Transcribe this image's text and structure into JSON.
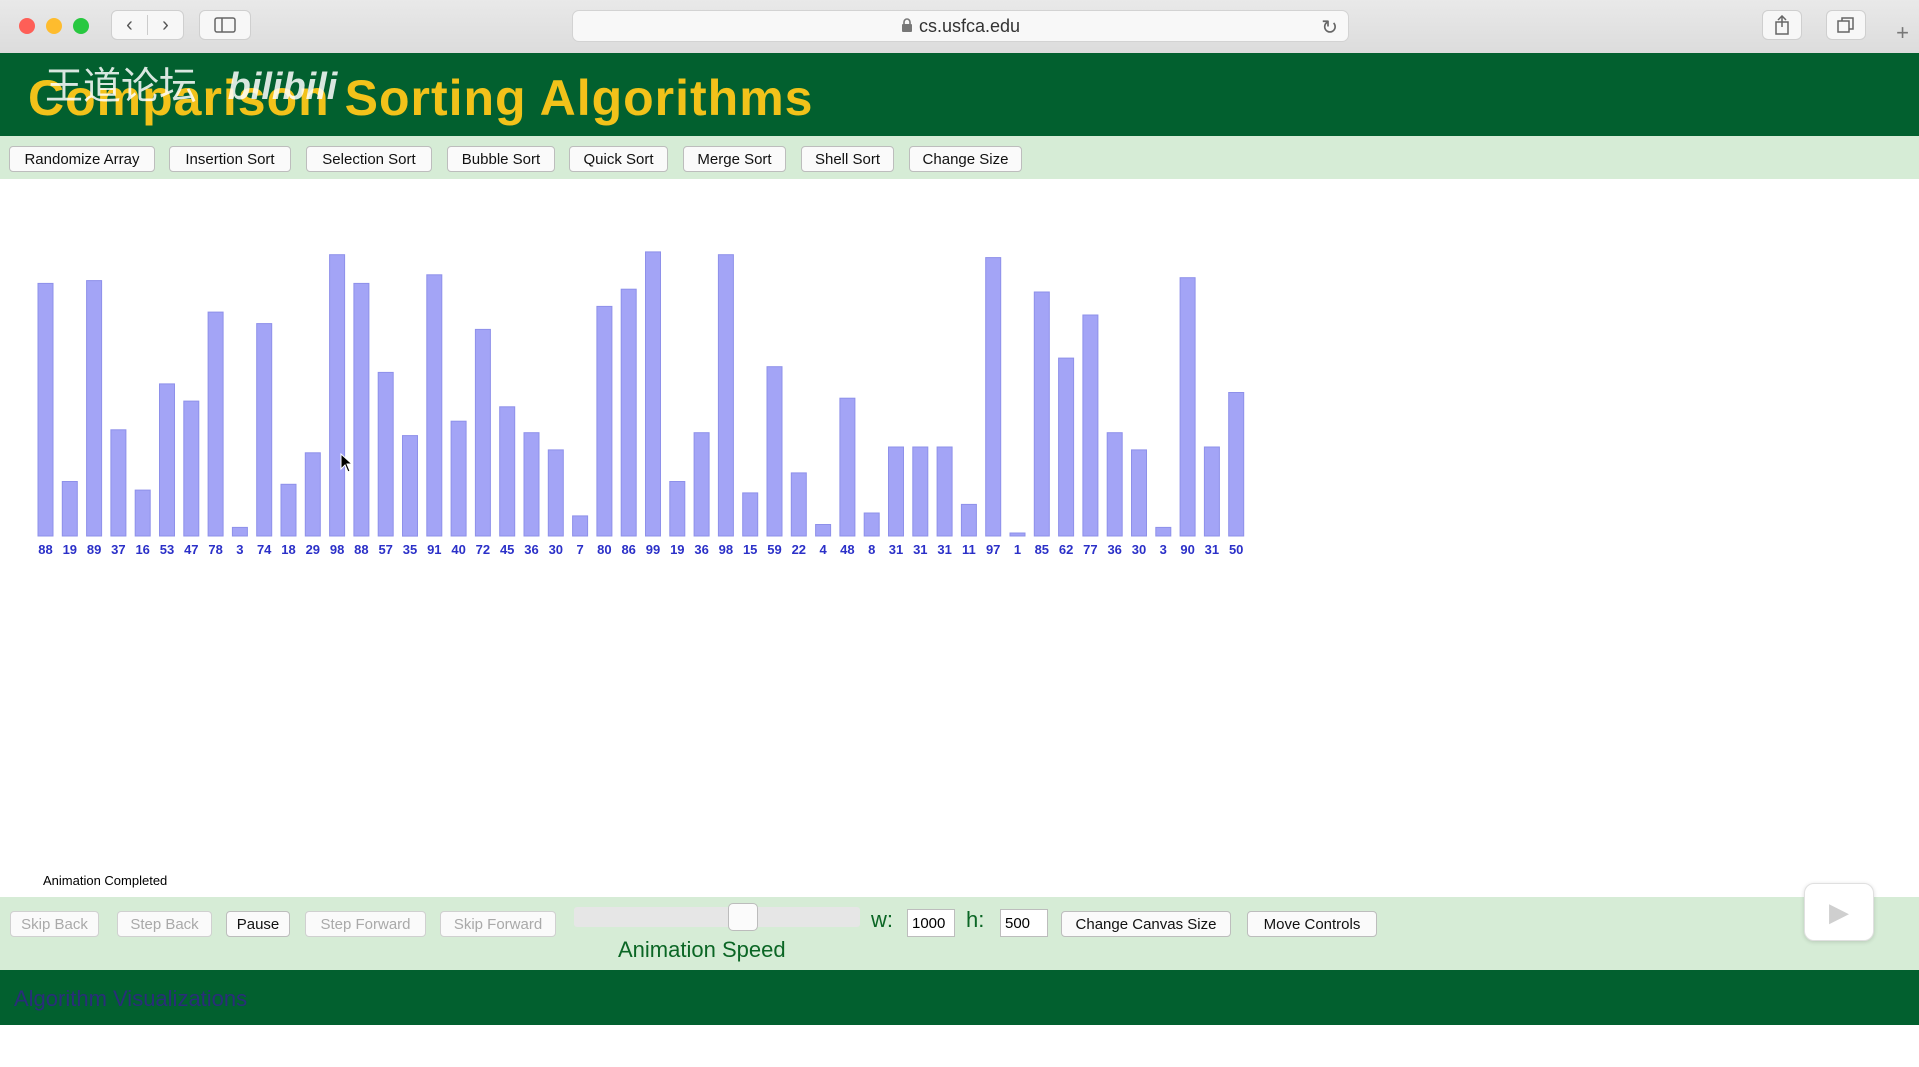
{
  "browser": {
    "url": "cs.usfca.edu",
    "icons": [
      "back-icon",
      "forward-icon",
      "sidebar-icon",
      "lock-icon",
      "reload-icon",
      "share-icon",
      "tabs-icon",
      "new-tab-icon"
    ]
  },
  "watermark": {
    "cn": "王道论坛",
    "bili": "bilibili"
  },
  "header": {
    "title": "Comparison Sorting Algorithms"
  },
  "toolbar": {
    "buttons": [
      "Randomize Array",
      "Insertion Sort",
      "Selection Sort",
      "Bubble Sort",
      "Quick Sort",
      "Merge Sort",
      "Shell Sort",
      "Change Size"
    ]
  },
  "chart_data": {
    "type": "bar",
    "categories": [
      "88",
      "19",
      "89",
      "37",
      "16",
      "53",
      "47",
      "78",
      "3",
      "74",
      "18",
      "29",
      "98",
      "88",
      "57",
      "35",
      "91",
      "40",
      "72",
      "45",
      "36",
      "30",
      "7",
      "80",
      "86",
      "99",
      "19",
      "36",
      "98",
      "15",
      "59",
      "22",
      "4",
      "48",
      "8",
      "31",
      "31",
      "31",
      "11",
      "97",
      "1",
      "85",
      "62",
      "77",
      "36",
      "30",
      "3",
      "90",
      "31",
      "50"
    ],
    "values": [
      88,
      19,
      89,
      37,
      16,
      53,
      47,
      78,
      3,
      74,
      18,
      29,
      98,
      88,
      57,
      35,
      91,
      40,
      72,
      45,
      36,
      30,
      7,
      80,
      86,
      99,
      19,
      36,
      98,
      15,
      59,
      22,
      4,
      48,
      8,
      31,
      31,
      31,
      11,
      97,
      1,
      85,
      62,
      77,
      36,
      30,
      3,
      90,
      31,
      50
    ],
    "ylim": [
      0,
      100
    ],
    "bar_color": "#a3a4f6",
    "label_color": "#2b30c8"
  },
  "status": {
    "text": "Animation Completed"
  },
  "controls": {
    "skip_back": "Skip Back",
    "step_back": "Step Back",
    "pause": "Pause",
    "step_forward": "Step Forward",
    "skip_forward": "Skip Forward",
    "speed_label": "Animation Speed",
    "speed_fraction": 0.6,
    "w_label": "w:",
    "w_value": "1000",
    "h_label": "h:",
    "h_value": "500",
    "change_canvas": "Change Canvas Size",
    "move_controls": "Move Controls"
  },
  "footer": {
    "text": "Algorithm Visualizations"
  },
  "colors": {
    "header_bg": "#02602f",
    "title": "#f2c21a",
    "toolbar_bg": "#d6ecd6"
  }
}
